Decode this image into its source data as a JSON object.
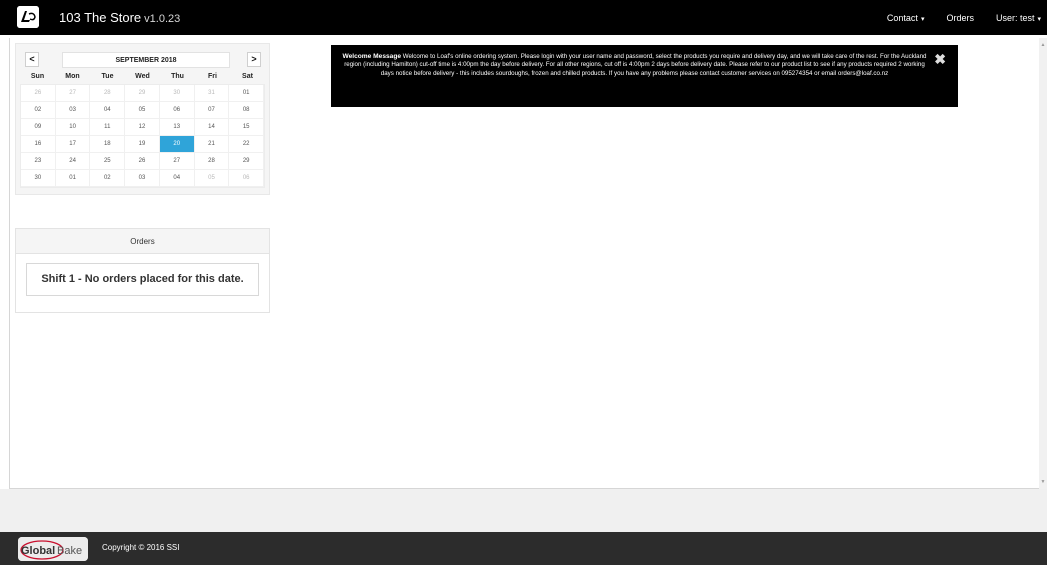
{
  "topbar": {
    "store_name": "103 The Store",
    "version": "v1.0.23",
    "nav": [
      {
        "label": "Contact",
        "caret": "▾"
      },
      {
        "label": "Orders",
        "caret": ""
      },
      {
        "label": "User: test",
        "caret": "▾"
      }
    ]
  },
  "calendar": {
    "prev_label": "<",
    "next_label": ">",
    "month": "SEPTEMBER 2018",
    "weekdays": [
      "Sun",
      "Mon",
      "Tue",
      "Wed",
      "Thu",
      "Fri",
      "Sat"
    ],
    "weeks": [
      [
        "26",
        "27",
        "28",
        "29",
        "30",
        "31",
        "01"
      ],
      [
        "02",
        "03",
        "04",
        "05",
        "06",
        "07",
        "08"
      ],
      [
        "09",
        "10",
        "11",
        "12",
        "13",
        "14",
        "15"
      ],
      [
        "16",
        "17",
        "18",
        "19",
        "20",
        "21",
        "22"
      ],
      [
        "23",
        "24",
        "25",
        "26",
        "27",
        "28",
        "29"
      ],
      [
        "30",
        "01",
        "02",
        "03",
        "04",
        "05",
        "06"
      ]
    ],
    "other_month": [
      [
        0,
        0
      ],
      [
        0,
        1
      ],
      [
        0,
        2
      ],
      [
        0,
        3
      ],
      [
        0,
        4
      ],
      [
        0,
        5
      ],
      [
        5,
        5
      ],
      [
        5,
        6
      ]
    ],
    "selected": [
      3,
      4
    ],
    "selected_color": "#2fa4d9"
  },
  "orders": {
    "heading": "Orders",
    "message": "Shift 1 - No orders placed for this date."
  },
  "welcome": {
    "heading": "Welcome Message",
    "text": "Welcome to Loaf's online ordering system. Please login with your user name and password, select the products you require and delivery day, and we will take care of the rest. For the Auckland region (including Hamilton) cut-off time is 4:00pm the day before delivery. For all other regions, cut off is 4:00pm 2 days before delivery date. Please refer to our product list to see if any products required 2 working days notice before delivery - this includes sourdoughs, frozen and chilled products.  If you have any problems please contact customer services on 095274354 or email orders@loaf.co.nz",
    "close_icon": "close-icon"
  },
  "footer": {
    "logo_left": "Global",
    "logo_right": "Bake",
    "copyright": "Copyright © 2016 SSI"
  }
}
